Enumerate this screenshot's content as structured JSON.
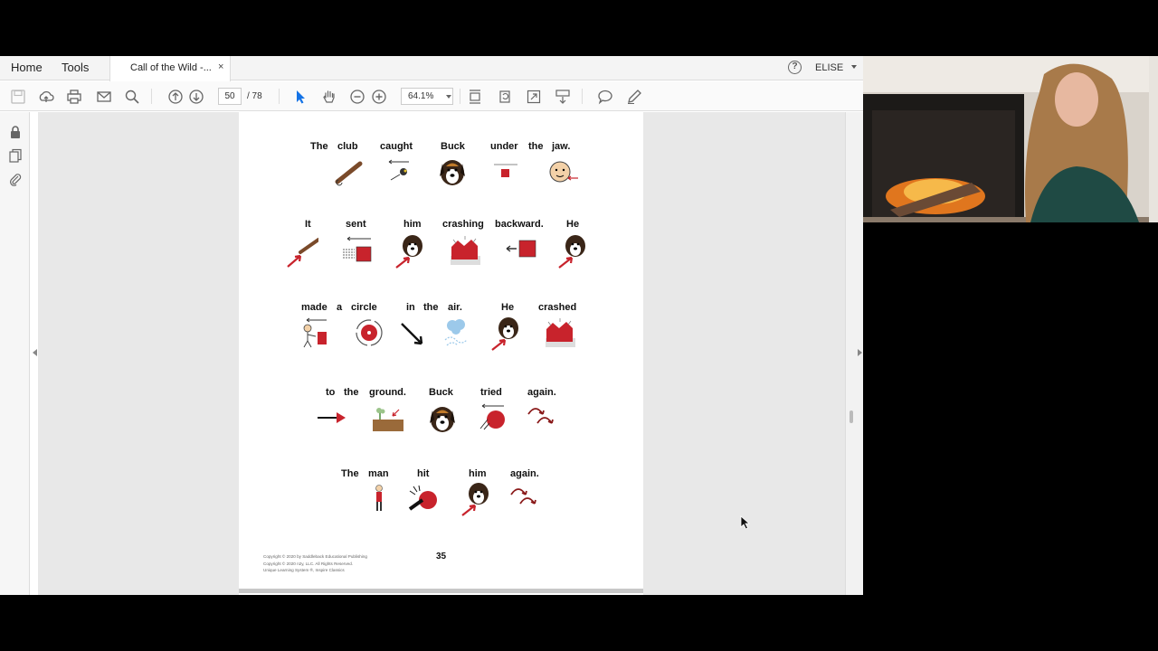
{
  "menubar": {
    "home_label": "Home",
    "tools_label": "Tools",
    "tab_title": "Call of the Wild -...",
    "tab_close": "×",
    "help_glyph": "?",
    "user_name": "ELISE"
  },
  "toolbar": {
    "current_page": "50",
    "total_pages": "/ 78",
    "zoom": "64.1%",
    "icons": [
      "save-icon",
      "upload-icon",
      "print-icon",
      "email-icon",
      "search-icon",
      "page-up-icon",
      "page-down-icon",
      "select-cursor-icon",
      "hand-icon",
      "zoom-out-icon",
      "zoom-in-icon",
      "fit-page-icon",
      "rotate-icon",
      "fullscreen-icon",
      "scroll-mode-icon",
      "comment-icon",
      "pen-icon"
    ]
  },
  "leftrail": {
    "icons": [
      "lock-icon",
      "pages-icon",
      "attachment-icon"
    ]
  },
  "page": {
    "rows": [
      {
        "words": [
          "The",
          "club",
          "caught",
          "Buck",
          "under",
          "the",
          "jaw."
        ],
        "symbols": [
          "club",
          "catch",
          "dog",
          "under",
          "face"
        ]
      },
      {
        "words": [
          "It",
          "sent",
          "him",
          "crashing",
          "backward.",
          "He"
        ],
        "symbols": [
          "it",
          "send",
          "him-dog",
          "crash",
          "backward",
          "he-dog"
        ]
      },
      {
        "words": [
          "made",
          "a",
          "circle",
          "in",
          "the",
          "air.",
          "He",
          "crashed"
        ],
        "symbols": [
          "make",
          "circle",
          "in",
          "air",
          "he-dog",
          "crash"
        ]
      },
      {
        "words": [
          "to",
          "the",
          "ground.",
          "Buck",
          "tried",
          "again."
        ],
        "symbols": [
          "to",
          "ground",
          "dog",
          "try",
          "again"
        ]
      },
      {
        "words": [
          "The",
          "man",
          "hit",
          "him",
          "again."
        ],
        "symbols": [
          "man",
          "hit",
          "him-dog",
          "again"
        ]
      }
    ],
    "copyright_lines": [
      "Copyright © 2020 by Saddleback Educational Publishing",
      "Copyright © 2020 n2y, LLC. All Rights Reserved.",
      "Unique Learning System ®, Inspire Classics"
    ],
    "page_number": "35"
  },
  "colors": {
    "symbol_red": "#c8232c",
    "menubar_bg": "#f4f4f4",
    "doc_bg": "#e8e8e8"
  }
}
